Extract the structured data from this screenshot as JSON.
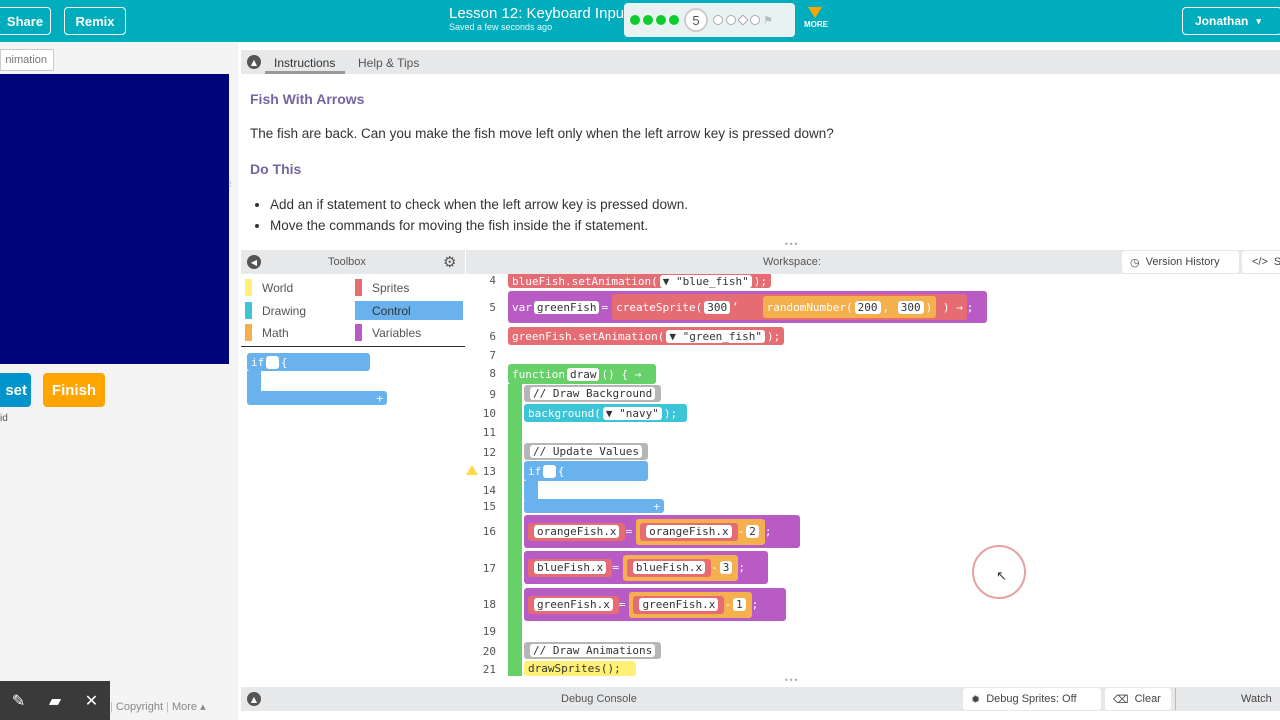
{
  "header": {
    "share_label": "Share",
    "remix_label": "Remix",
    "lesson_title": "Lesson 12: Keyboard Input",
    "saved_text": "Saved a few seconds ago",
    "current_level": "5",
    "more_label": "MORE",
    "user_name": "Jonathan"
  },
  "left": {
    "animation_tag": "nimation",
    "reset_label": "set",
    "finish_label": "Finish",
    "id_text": "id",
    "footer_copyright": "Copyright",
    "footer_more": "More ▴"
  },
  "instructions": {
    "tab_instructions": "Instructions",
    "tab_help": "Help & Tips",
    "heading": "Fish With Arrows",
    "paragraph": "The fish are back. Can you make the fish move left only when the left arrow key is pressed down?",
    "do_this": "Do This",
    "bullets": [
      "Add an if statement to check when the left arrow key is pressed down.",
      "Move the commands for moving the fish inside the if statement."
    ]
  },
  "toolbox": {
    "title": "Toolbox",
    "categories": [
      {
        "label": "World",
        "color": "#fff176"
      },
      {
        "label": "Sprites",
        "color": "#e66c73"
      },
      {
        "label": "Drawing",
        "color": "#3dc5d7"
      },
      {
        "label": "Control",
        "color": "#6ab2ed"
      },
      {
        "label": "Math",
        "color": "#f5b04e"
      },
      {
        "label": "Variables",
        "color": "#b95bc4"
      }
    ],
    "if_block": "if",
    "if_brace": "{"
  },
  "workspace": {
    "title": "Workspace:",
    "version_history": "Version History",
    "show_code": "S",
    "lines": {
      "l4": "4",
      "l5": "5",
      "l6": "6",
      "l7": "7",
      "l8": "8",
      "l9": "9",
      "l10": "10",
      "l11": "11",
      "l12": "12",
      "l13": "13",
      "l14": "14",
      "l15": "15",
      "l16": "16",
      "l17": "17",
      "l18": "18",
      "l19": "19",
      "l20": "20",
      "l21": "21"
    },
    "code": {
      "bluefish": "blueFish",
      "set_anim": ".setAnimation(",
      "blue_fish_str": "▼ \"blue_fish\"",
      "close_paren": ");",
      "var_kw": "var",
      "greenfish": "greenFish",
      "eq": "=",
      "create_sprite": "createSprite(",
      "n300": "300",
      "random_number": "randomNumber(",
      "n200": "200",
      "green_fish_str": "▼ \"green_fish\"",
      "function_kw": "function",
      "draw": "draw",
      "fn_parens": "() {",
      "comment_bg": "// Draw Background",
      "background": "background(",
      "navy_str": "▼ \"navy\"",
      "comment_update": "// Update Values",
      "if_kw": "if",
      "orangefish_x": "orangeFish.x",
      "bluefish_x": "blueFish.x",
      "greenfish_x": "greenFish.x",
      "minus": "-",
      "n2": "2",
      "n3": "3",
      "n1": "1",
      "comment_anim": "// Draw Animations",
      "draw_sprites": "drawSprites();"
    }
  },
  "debug": {
    "title": "Debug Console",
    "debug_sprites": "Debug Sprites: Off",
    "clear": "Clear",
    "watch": "Watch"
  }
}
